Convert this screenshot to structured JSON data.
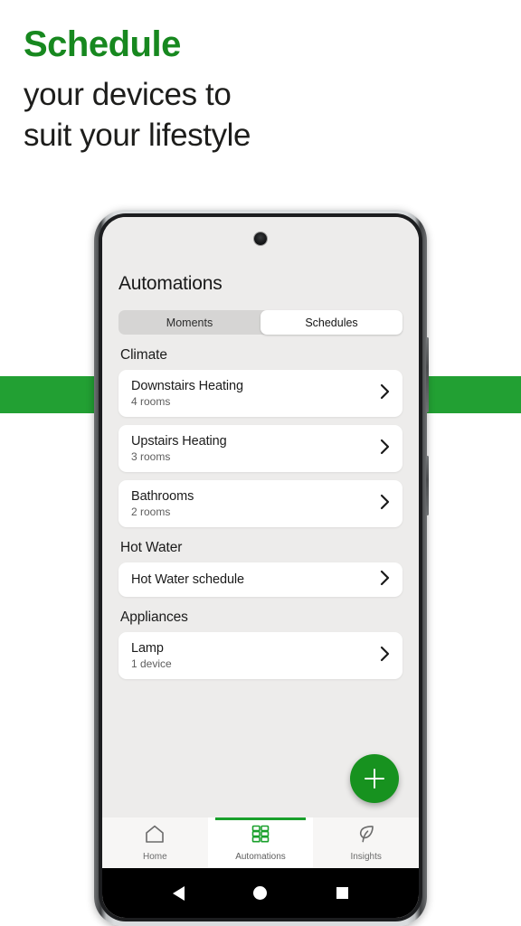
{
  "promo": {
    "headline": "Schedule",
    "subline_1": "your devices to",
    "subline_2": "suit your lifestyle",
    "accent_color": "#17881f",
    "stripe_color": "#22a033"
  },
  "app": {
    "title": "Automations",
    "segmented": {
      "options": [
        {
          "label": "Moments",
          "active": false
        },
        {
          "label": "Schedules",
          "active": true
        }
      ]
    },
    "sections": [
      {
        "header": "Climate",
        "items": [
          {
            "title": "Downstairs Heating",
            "subtitle": "4 rooms"
          },
          {
            "title": "Upstairs Heating",
            "subtitle": "3 rooms"
          },
          {
            "title": "Bathrooms",
            "subtitle": "2 rooms"
          }
        ]
      },
      {
        "header": "Hot Water",
        "items": [
          {
            "title": "Hot Water schedule",
            "subtitle": ""
          }
        ]
      },
      {
        "header": "Appliances",
        "items": [
          {
            "title": "Lamp",
            "subtitle": "1 device"
          }
        ]
      }
    ],
    "fab": {
      "icon": "plus-icon",
      "color": "#17921f"
    },
    "tabbar": {
      "tabs": [
        {
          "label": "Home",
          "icon": "home-icon",
          "active": false
        },
        {
          "label": "Automations",
          "icon": "grid-icon",
          "active": true
        },
        {
          "label": "Insights",
          "icon": "leaf-icon",
          "active": false
        }
      ],
      "active_color": "#19a02b"
    }
  },
  "system_nav": {
    "back": "back-triangle-icon",
    "home": "home-circle-icon",
    "recents": "recents-square-icon"
  }
}
